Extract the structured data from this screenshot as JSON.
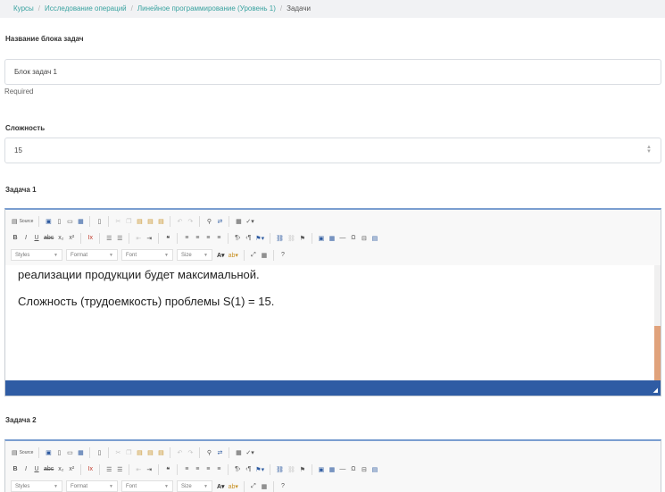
{
  "breadcrumb": {
    "items": [
      "Курсы",
      "Исследование операций",
      "Линейное программирование (Уровень 1)"
    ],
    "current": "Задачи"
  },
  "block_name": {
    "label": "Название блока задач",
    "value": "Блок задач 1",
    "help": "Required"
  },
  "difficulty": {
    "label": "Сложность",
    "value": "15"
  },
  "toolbar": {
    "source_label": "Source",
    "combos": [
      "Styles",
      "Format",
      "Font",
      "Size"
    ]
  },
  "task1": {
    "label": "Задача 1",
    "paragraphs": [
      "реализации продукции будет максимальной.",
      "Сложность (трудоемкость) проблемы S(1) = 15."
    ]
  },
  "task2": {
    "label": "Задача 2"
  },
  "colors": {
    "link": "#3aa3a0",
    "statusbar": "#2f5ca4",
    "scroll_thumb": "#e0a27b"
  }
}
